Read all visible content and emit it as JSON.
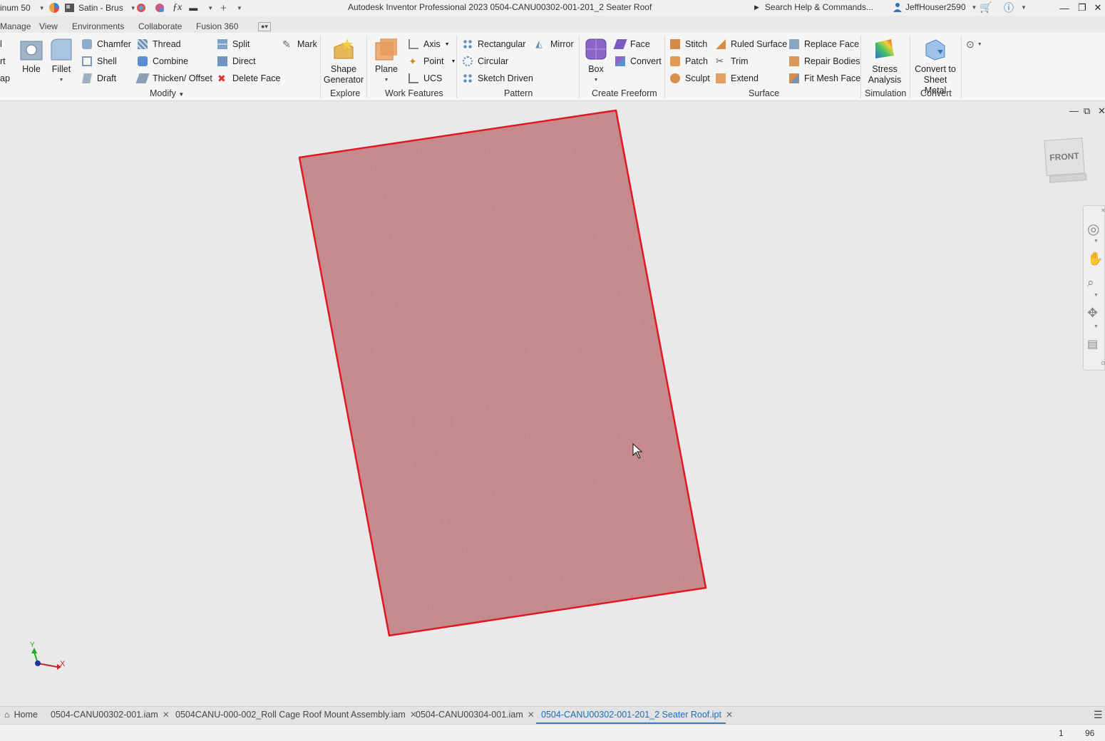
{
  "titlebar": {
    "material": "inum 50",
    "appearance": "Satin - Brus",
    "title": "Autodesk Inventor Professional 2023    0504-CANU00302-001-201_2 Seater Roof",
    "search": "Search Help & Commands...",
    "user": "JeffHouser2590"
  },
  "tabs": [
    "Manage",
    "View",
    "Environments",
    "Collaborate",
    "Fusion 360"
  ],
  "ribbon": {
    "partial_left": [
      "l",
      "rt",
      "ap"
    ],
    "hole": "Hole",
    "fillet": "Fillet",
    "modify_col1": [
      "Chamfer",
      "Shell",
      "Draft"
    ],
    "modify_col2": [
      "Thread",
      "Combine",
      "Thicken/ Offset"
    ],
    "modify_col3": [
      "Split",
      "Direct",
      "Delete Face"
    ],
    "mark": "Mark",
    "modify_label": "Modify",
    "shape_generator": "Shape Generator",
    "explore_label": "Explore",
    "plane": "Plane",
    "work_items": [
      "Axis",
      "Point",
      "UCS"
    ],
    "work_label": "Work Features",
    "pattern_items": [
      "Rectangular",
      "Circular",
      "Sketch Driven"
    ],
    "mirror": "Mirror",
    "pattern_label": "Pattern",
    "box": "Box",
    "freeform_items": [
      "Face",
      "Convert"
    ],
    "freeform_label": "Create Freeform",
    "surface_col1": [
      "Stitch",
      "Patch",
      "Sculpt"
    ],
    "surface_col2": [
      "Ruled Surface",
      "Trim",
      "Extend"
    ],
    "surface_col3": [
      "Replace Face",
      "Repair Bodies",
      "Fit Mesh Face"
    ],
    "surface_label": "Surface",
    "stress": "Stress Analysis",
    "simulation_label": "Simulation",
    "convert_sm": "Convert to Sheet Metal",
    "convert_label": "Convert"
  },
  "viewport": {
    "viewcube_label": "FRONT",
    "axis_x": "X",
    "axis_y": "Y",
    "part_color": "#c4878a",
    "edge_color": "#e0141e"
  },
  "doctabs": {
    "home": "Home",
    "tabs": [
      "0504-CANU00302-001.iam",
      "0504CANU-000-002_Roll Cage Roof Mount Assembly.iam",
      "0504-CANU00304-001.iam",
      "0504-CANU00302-001-201_2 Seater Roof.ipt"
    ]
  },
  "status": {
    "a": "1",
    "b": "96"
  }
}
